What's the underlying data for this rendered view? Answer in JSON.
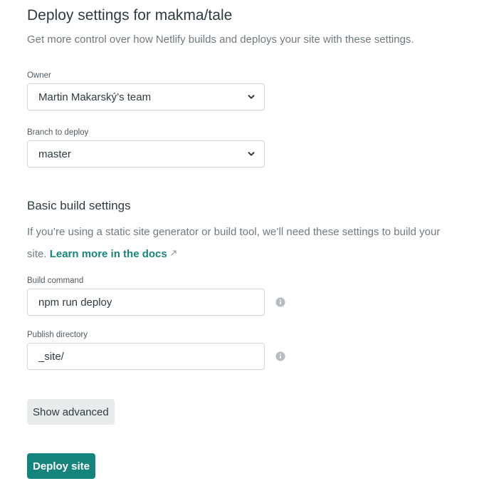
{
  "header": {
    "title": "Deploy settings for makma/tale",
    "subtitle": "Get more control over how Netlify builds and deploys your site with these settings."
  },
  "owner": {
    "label": "Owner",
    "selected": "Martin Makarský’s team"
  },
  "branch": {
    "label": "Branch to deploy",
    "selected": "master"
  },
  "build_settings": {
    "title": "Basic build settings",
    "description": "If you’re using a static site generator or build tool, we’ll need these settings to build your site.",
    "learn_more_label": "Learn more in the docs",
    "build_command": {
      "label": "Build command",
      "value": "npm run deploy"
    },
    "publish_directory": {
      "label": "Publish directory",
      "value": "_site/"
    }
  },
  "actions": {
    "show_advanced_label": "Show advanced",
    "deploy_label": "Deploy site"
  },
  "colors": {
    "accent": "#15847d",
    "text": "#2d3b41",
    "muted_text": "#6e7a80",
    "border": "#d2d7da",
    "secondary_button_bg": "#e8ebec"
  },
  "icons": {
    "select_chevron": "chevron-down-icon",
    "external_link": "external-link-icon",
    "help": "info-icon"
  }
}
